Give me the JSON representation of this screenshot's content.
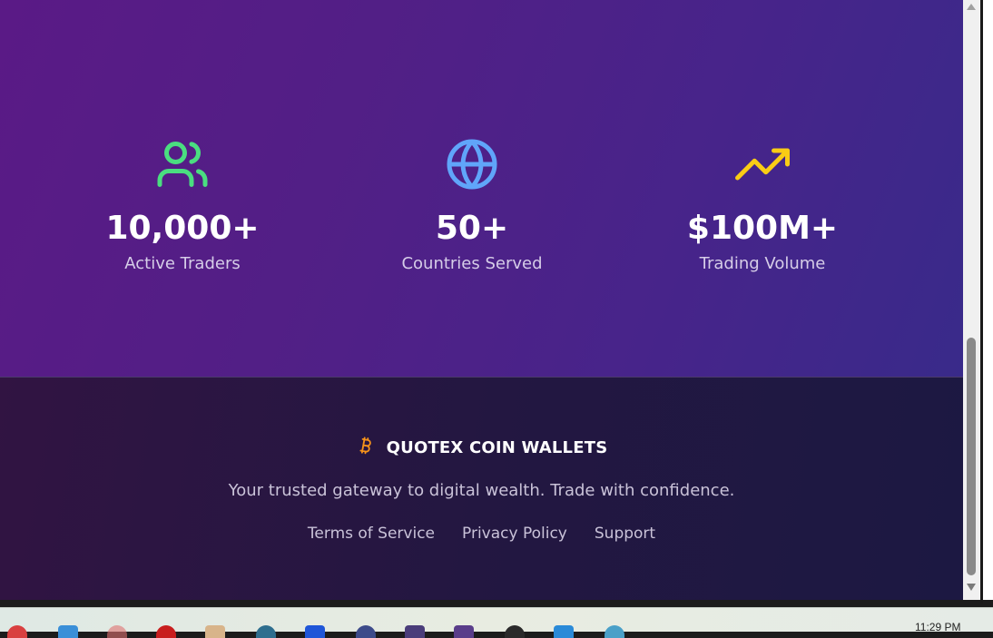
{
  "stats": [
    {
      "icon": "users-icon",
      "value": "10,000+",
      "label": "Active Traders",
      "color": "#4ade80"
    },
    {
      "icon": "globe-icon",
      "value": "50+",
      "label": "Countries Served",
      "color": "#60a5fa"
    },
    {
      "icon": "trending-up-icon",
      "value": "$100M+",
      "label": "Trading Volume",
      "color": "#facc15"
    }
  ],
  "footer": {
    "brand_icon": "bitcoin-icon",
    "brand_color": "#f7931a",
    "brand_name": "QUOTEX COIN WALLETS",
    "tagline": "Your trusted gateway to digital wealth. Trade with confidence.",
    "links": [
      "Terms of Service",
      "Privacy Policy",
      "Support"
    ]
  },
  "taskbar": {
    "clock": "11:29 PM"
  }
}
